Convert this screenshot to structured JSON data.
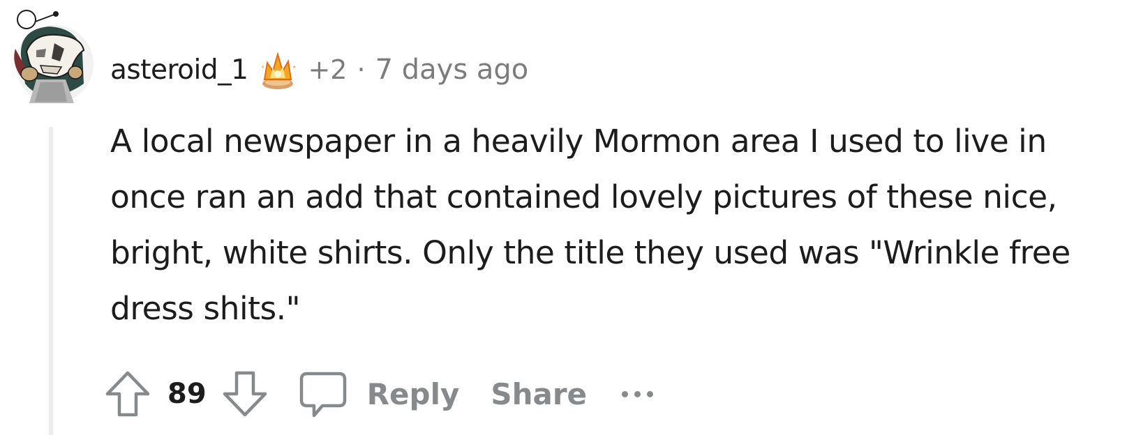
{
  "comment": {
    "username": "asteroid_1",
    "award_count": "+2",
    "separator": "·",
    "timestamp": "7 days ago",
    "body": "A local newspaper in a heavily Mormon area I used to live in once ran an add that contained lovely pictures of these nice, bright, white shirts. Only the title they used was \"Wrinkle free dress shits.\""
  },
  "actions": {
    "vote_count": "89",
    "reply_label": "Reply",
    "share_label": "Share"
  },
  "icons": {
    "avatar": "user-avatar",
    "award": "award-icon",
    "upvote": "upvote-arrow-icon",
    "downvote": "downvote-arrow-icon",
    "comment": "comment-bubble-icon",
    "more": "more-options-icon"
  },
  "colors": {
    "meta_text": "#7c7c7c",
    "action_text": "#878a8c",
    "thread_line": "#ececec"
  }
}
